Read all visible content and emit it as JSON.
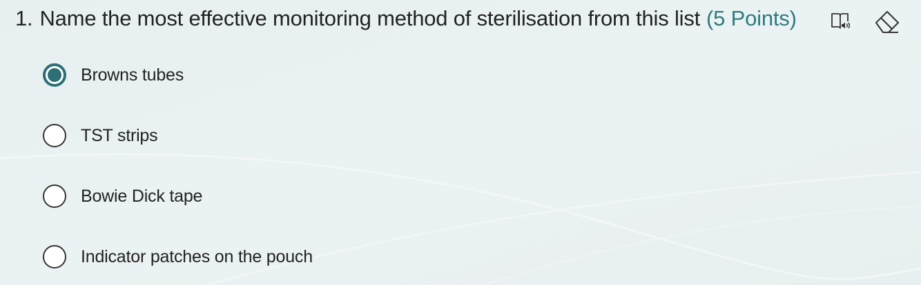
{
  "question": {
    "number": "1.",
    "text": "Name the most effective monitoring method of sterilisation from this list",
    "points": "(5 Points)"
  },
  "tools": [
    {
      "name": "immersive-reader",
      "icon": "immersive-reader-icon"
    },
    {
      "name": "clear-answer",
      "icon": "eraser-icon"
    }
  ],
  "options": [
    {
      "label": "Browns tubes",
      "selected": true
    },
    {
      "label": "TST strips",
      "selected": false
    },
    {
      "label": "Bowie Dick tape",
      "selected": false
    },
    {
      "label": "Indicator patches on the pouch",
      "selected": false
    }
  ],
  "colors": {
    "accent": "#2c6f74",
    "points_text": "#2f7b80",
    "background": "#e9f0f1"
  }
}
